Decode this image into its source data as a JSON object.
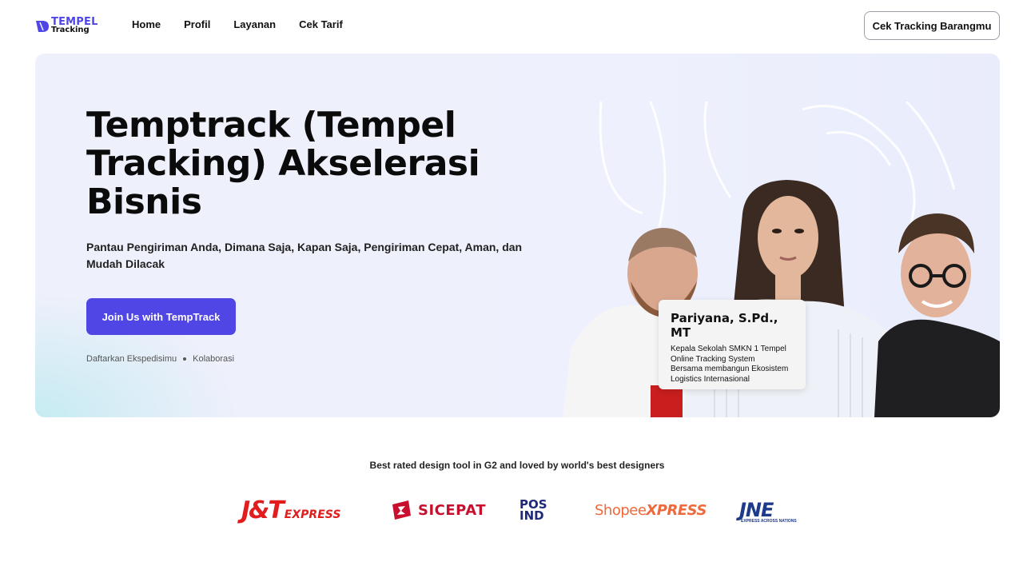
{
  "brand": {
    "logo_top": "TEMPEL",
    "logo_bottom": "Tracking",
    "accent": "#4f46e5"
  },
  "nav": {
    "items": [
      {
        "label": "Home"
      },
      {
        "label": "Profil"
      },
      {
        "label": "Layanan"
      },
      {
        "label": "Cek Tarif"
      }
    ],
    "cta_label": "Cek Tracking Barangmu"
  },
  "hero": {
    "title": "Temptrack (Tempel Tracking) Akselerasi Bisnis",
    "subtitle": "Pantau Pengiriman Anda, Dimana Saja, Kapan Saja, Pengiriman Cepat, Aman, dan Mudah Dilacak",
    "button_label": "Join Us with TempTrack",
    "links": [
      "Daftarkan Ekspedisimu",
      "Kolaborasi"
    ],
    "profile_card": {
      "name": "Pariyana, S.Pd., MT",
      "lines": [
        "Kepala Sekolah SMKN 1 Tempel",
        "Online Tracking System",
        "Bersama membangun Ekosistem",
        "Logistics Internasional"
      ]
    }
  },
  "partners": {
    "caption": "Best rated design tool in G2 and loved by world's best designers",
    "logos": {
      "jt_main": "J&T",
      "jt_sub": "EXPRESS",
      "sicepat": "SICEPAT",
      "pos_top": "POS",
      "pos_bottom": "IND",
      "shopee_a": "Shopee",
      "shopee_b": "XPRESS",
      "jne": "JNE",
      "jne_tag": "EXPRESS ACROSS NATIONS"
    }
  }
}
